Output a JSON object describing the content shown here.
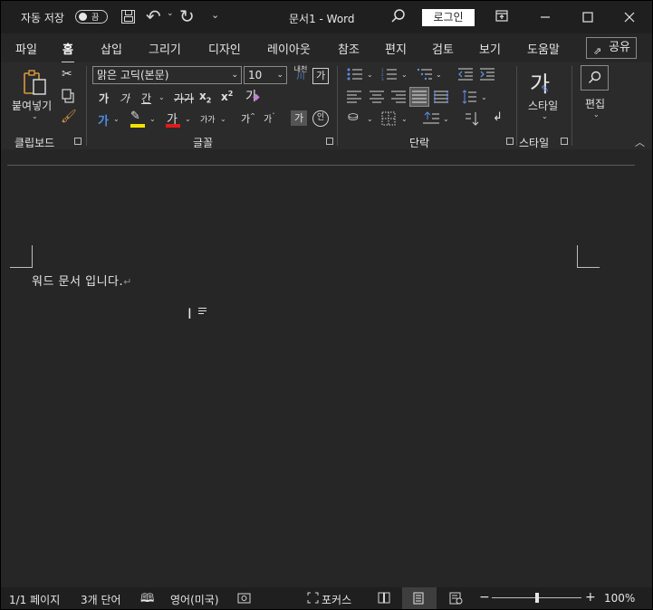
{
  "title_bar": {
    "autosave_label": "자동 저장",
    "autosave_toggle": "끔",
    "document_title": "문서1  -  Word",
    "login_button": "로그인",
    "icons": [
      "save-icon",
      "undo-icon",
      "redo-icon",
      "customize-quick-access-icon",
      "search-icon",
      "ribbon-display-options-icon",
      "minimize-icon",
      "maximize-icon",
      "close-icon"
    ]
  },
  "tabs": {
    "items": [
      {
        "label": "파일"
      },
      {
        "label": "홈"
      },
      {
        "label": "삽입"
      },
      {
        "label": "그리기"
      },
      {
        "label": "디자인"
      },
      {
        "label": "레이아웃"
      },
      {
        "label": "참조"
      },
      {
        "label": "편지"
      },
      {
        "label": "검토"
      },
      {
        "label": "보기"
      },
      {
        "label": "도움말"
      }
    ],
    "active": "홈",
    "share_label": "공유"
  },
  "ribbon": {
    "clipboard": {
      "paste_label": "붙여넣기",
      "group_label": "클립보드"
    },
    "font": {
      "font_name": "맑은 고딕(본문)",
      "font_size": "10",
      "bold": "가",
      "italic": "가",
      "underline": "간",
      "strikethrough": "가",
      "subscript": "x",
      "superscript": "x",
      "subscript_mark": "2",
      "superscript_mark": "2",
      "phonetic_guide_top": "내천",
      "phonetic_guide_bottom": "川",
      "char_border": "가",
      "clear_format": "가",
      "text_effects": "가",
      "font_color": "가",
      "char_scale": "가가",
      "grow_font": "가",
      "shrink_font": "가",
      "char_shading": "가",
      "enclose_char": "인",
      "group_label": "글꼴",
      "colors": {
        "highlight": "#f5e100",
        "font_color": "#e01b1b",
        "text_effects": "#3b78e7"
      }
    },
    "paragraph": {
      "group_label": "단락"
    },
    "styles": {
      "style_glyph": "가",
      "styles_label": "스타일",
      "group_label": "스타일"
    },
    "editing": {
      "label": "편집"
    }
  },
  "document": {
    "text": "워드 문서 입니다.",
    "paragraph_mark": "↵"
  },
  "status_bar": {
    "page": "1/1 페이지",
    "words": "3개 단어",
    "language": "영어(미국)",
    "focus": "포커스",
    "zoom_minus": "−",
    "zoom_plus": "+",
    "zoom": "100%",
    "zoom_level_fraction": 0.5
  }
}
